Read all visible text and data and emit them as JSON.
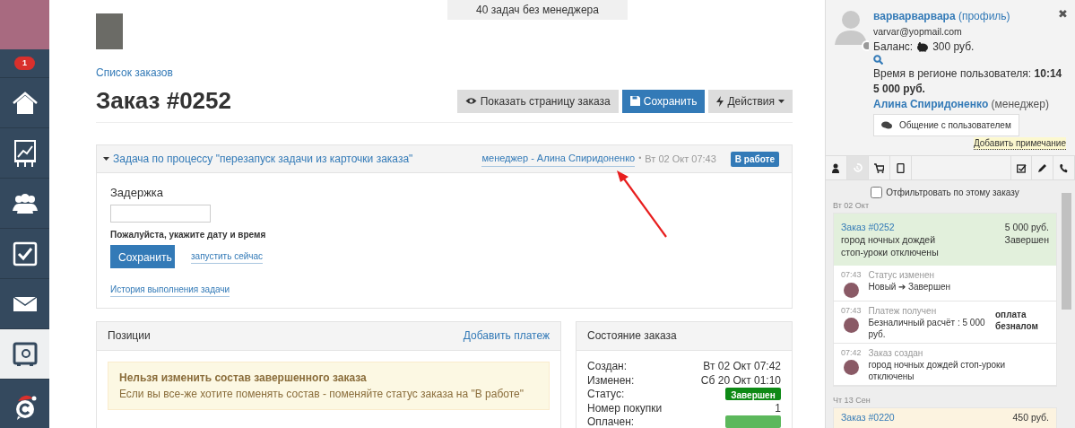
{
  "sidebar": {
    "badge": "1",
    "items": [
      {
        "kind": "home",
        "selected": false
      },
      {
        "kind": "chart",
        "selected": false
      },
      {
        "kind": "people",
        "selected": false
      },
      {
        "kind": "check",
        "selected": false
      },
      {
        "kind": "mail",
        "selected": false
      },
      {
        "kind": "safe",
        "selected": true
      },
      {
        "kind": "logo",
        "selected": false
      }
    ]
  },
  "banner": "40 задач без менеджера",
  "breadcrumb": "Список заказов",
  "title": "Заказ #0252",
  "actions": [
    {
      "kind": "view",
      "label": "Показать страницу заказа"
    },
    {
      "kind": "save",
      "label": "Сохранить"
    },
    {
      "kind": "menu",
      "label": "Действия"
    }
  ],
  "task": {
    "title": "Задача по процессу \"перезапуск задачи из карточки заказа\"",
    "manager": "менеджер - Алина Спиридоненко",
    "separator": "•",
    "time": "Вт 02 Окт 07:43",
    "status": "В работе",
    "delay_label": "Задержка",
    "delay_hint": "Пожалуйста, укажите дату и время",
    "save": "Сохранить",
    "run_now": "запустить сейчас",
    "history": "История выполнения задачи"
  },
  "positions": {
    "title": "Позиции",
    "add_payment": "Добавить платеж",
    "alert_title": "Нельзя изменить состав завершенного заказа",
    "alert_text": "Если вы все-же хотите поменять состав - поменяйте статус заказа на \"В работе\""
  },
  "order_state": {
    "title": "Состояние заказа",
    "rows": [
      {
        "kind": "text",
        "label": "Создан:",
        "value": "Вт 02 Окт 07:42"
      },
      {
        "kind": "text",
        "label": "Изменен:",
        "value": "Сб 20 Окт 01:10"
      },
      {
        "kind": "badge",
        "label": "Статус:",
        "value": "Завершен",
        "color": "#0e8a16"
      },
      {
        "kind": "text",
        "label": "Номер покупки",
        "value": "1"
      },
      {
        "kind": "badge",
        "label": "Оплачен:",
        "color": "#5cb85c"
      }
    ]
  },
  "customer": {
    "name": "варварварвара",
    "profile": "(профиль)",
    "email": "varvar@yopmail.com",
    "online": false,
    "balance_label": "Баланс:",
    "balance": "300 руб.",
    "time_label": "Время в регионе пользователя:",
    "time": "10:14",
    "total": "5 000 руб.",
    "manager": "Алина Спиридоненко",
    "manager_role": "(менеджер)",
    "chat_button": "Общение с пользователем",
    "add_note": "Добавить примечание",
    "close": "✖"
  },
  "panel_tabs": [
    {
      "kind": "person",
      "selected": false
    },
    {
      "kind": "history",
      "selected": true
    },
    {
      "kind": "cart",
      "selected": false
    },
    {
      "kind": "mobile",
      "selected": false
    },
    {
      "kind": "tasks",
      "selected": false
    },
    {
      "kind": "edit",
      "selected": false
    },
    {
      "kind": "phone",
      "selected": false
    }
  ],
  "filter": {
    "label": "Отфильтровать по этому заказу",
    "checked": false
  },
  "timeline": [
    {
      "date": "Вт 02 Окт",
      "order": {
        "number": "Заказ #0252",
        "amount": "5 000 руб.",
        "lines": [
          "город ночных дождей",
          "стоп-уроки отключены"
        ],
        "status": "Завершен",
        "color": "#e2f0dc"
      },
      "events": [
        {
          "time": "07:43",
          "title": "Статус изменен",
          "text": "Новый ➔ Завершен"
        },
        {
          "time": "07:43",
          "title": "Платеж получен",
          "text": "Безналичный расчёт : 5 000 руб.",
          "note": "оплата безналом"
        },
        {
          "time": "07:42",
          "title": "Заказ создан",
          "text": "город ночных дождей стоп-уроки отключены"
        }
      ]
    },
    {
      "date": "Чт 13 Сен",
      "order": {
        "number": "Заказ #0220",
        "amount": "450 руб.",
        "color": "#fcf3e0"
      }
    }
  ]
}
